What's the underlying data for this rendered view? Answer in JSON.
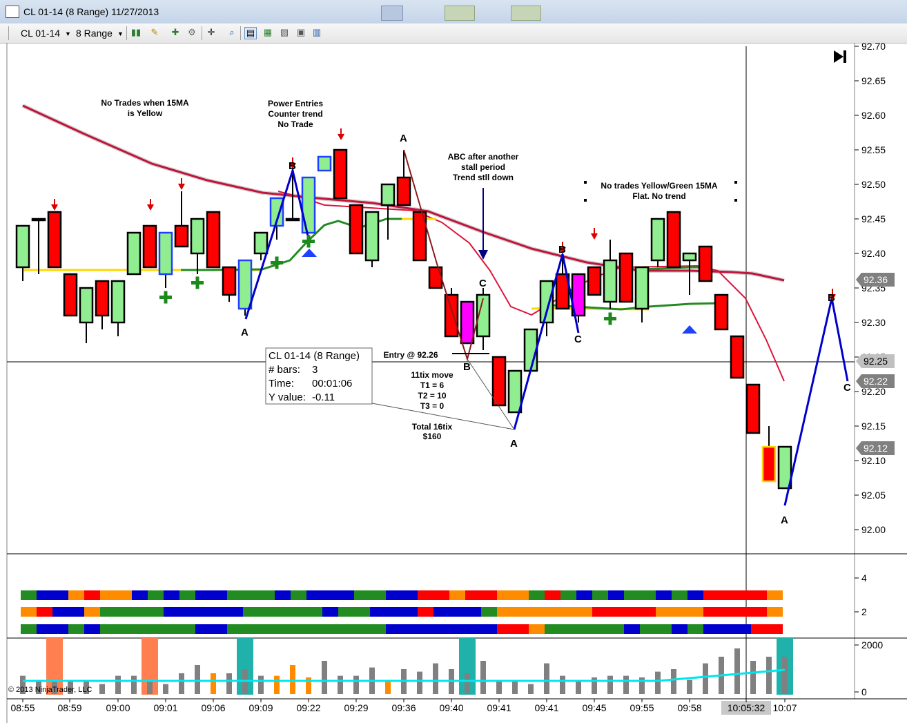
{
  "window": {
    "title": "CL 01-14 (8 Range)  11/27/2013",
    "minimized_thumbs": [
      "app-thumb-1",
      "app-thumb-2",
      "app-thumb-3"
    ]
  },
  "toolbar": {
    "instrument": "CL 01-14",
    "interval": "8 Range",
    "icons": [
      "bar-style-icon",
      "pencil-icon",
      "add-indicator-icon",
      "strategy-icon",
      "crosshair-icon",
      "zoom-icon",
      "data-box-icon",
      "chart-trader-icon",
      "chart-icon",
      "snapshot-icon",
      "properties-icon"
    ]
  },
  "price_axis": {
    "ticks": [
      "92.70",
      "92.65",
      "92.60",
      "92.55",
      "92.50",
      "92.45",
      "92.40",
      "92.35",
      "92.30",
      "92.25",
      "92.20",
      "92.15",
      "92.10",
      "92.05",
      "92.00"
    ],
    "markers": [
      {
        "label": "92.36",
        "bg": "#808080"
      },
      {
        "label": "92.25",
        "bg": "#c0c0c0"
      },
      {
        "label": "92.22",
        "bg": "#808080"
      },
      {
        "label": "92.12",
        "bg": "#808080"
      }
    ]
  },
  "time_axis": {
    "labels": [
      "08:55",
      "08:59",
      "09:00",
      "09:01",
      "09:06",
      "09:09",
      "09:22",
      "09:29",
      "09:36",
      "09:40",
      "09:41",
      "09:41",
      "09:45",
      "09:55",
      "09:58",
      "10:05:32",
      "10:07"
    ],
    "crosshair_label": "10:05:32"
  },
  "panel2_axis": {
    "ticks": [
      "4",
      "2"
    ]
  },
  "panel3_axis": {
    "ticks": [
      "2000",
      "0"
    ]
  },
  "annotations": {
    "no_trades_15ma": [
      "No Trades when 15MA",
      "is Yellow"
    ],
    "power_entries": [
      "Power Entries",
      "Counter trend",
      "No Trade"
    ],
    "abc_after": [
      "ABC after another",
      "stall period",
      "Trend stll down"
    ],
    "no_trades_yellow_green": [
      "No trades Yellow/Green 15MA",
      "Flat.  No trend"
    ],
    "entry": "Entry @ 92.26",
    "move": [
      "11tix move",
      "T1 = 6",
      "T2 = 10",
      "T3 = 0"
    ],
    "total": [
      "Total 16tix",
      "$160"
    ]
  },
  "wave_labels": [
    {
      "text": "A"
    },
    {
      "text": "B"
    },
    {
      "text": "A"
    },
    {
      "text": "B"
    },
    {
      "text": "C"
    },
    {
      "text": "A"
    },
    {
      "text": "B"
    },
    {
      "text": "C"
    },
    {
      "text": "A"
    },
    {
      "text": "B"
    },
    {
      "text": "C"
    }
  ],
  "data_box": {
    "title": "CL 01-14 (8 Range)",
    "rows": [
      {
        "label": "# bars:",
        "value": "3"
      },
      {
        "label": "Time:",
        "value": "00:01:06"
      },
      {
        "label": "Y value:",
        "value": "-0.11"
      }
    ]
  },
  "copyright": "© 2013 NinjaTrader, LLC",
  "colors": {
    "bull": "#90ee90",
    "bear": "#ff0000",
    "magenta": "#ff00ff",
    "ma_slow": "#c0143c",
    "ma_fast": "#dc143c",
    "ma15_green": "#228b22",
    "ma15_yellow": "#ffd700",
    "zigzag": "#0000cd",
    "volume": "#808080",
    "volume_avg": "#00e5ee"
  },
  "chart_data": {
    "type": "candlestick",
    "ylim": [
      91.96,
      92.7
    ],
    "candles": [
      {
        "o": 92.38,
        "h": 92.44,
        "l": 92.36,
        "c": 92.44
      },
      {
        "o": 92.45,
        "h": 92.45,
        "l": 92.37,
        "c": 92.45
      },
      {
        "o": 92.46,
        "h": 92.46,
        "l": 92.38,
        "c": 92.38
      },
      {
        "o": 92.37,
        "h": 92.37,
        "l": 92.31,
        "c": 92.31
      },
      {
        "o": 92.3,
        "h": 92.35,
        "l": 92.27,
        "c": 92.35
      },
      {
        "o": 92.36,
        "h": 92.36,
        "l": 92.29,
        "c": 92.31
      },
      {
        "o": 92.3,
        "h": 92.36,
        "l": 92.28,
        "c": 92.36
      },
      {
        "o": 92.37,
        "h": 92.43,
        "l": 92.37,
        "c": 92.43
      },
      {
        "o": 92.44,
        "h": 92.44,
        "l": 92.38,
        "c": 92.38
      },
      {
        "o": 92.37,
        "h": 92.43,
        "l": 92.35,
        "c": 92.43
      },
      {
        "o": 92.44,
        "h": 92.49,
        "l": 92.41,
        "c": 92.41
      },
      {
        "o": 92.4,
        "h": 92.45,
        "l": 92.37,
        "c": 92.45
      },
      {
        "o": 92.46,
        "h": 92.46,
        "l": 92.38,
        "c": 92.38
      },
      {
        "o": 92.38,
        "h": 92.38,
        "l": 92.33,
        "c": 92.34
      },
      {
        "o": 92.32,
        "h": 92.39,
        "l": 92.31,
        "c": 92.39
      },
      {
        "o": 92.4,
        "h": 92.43,
        "l": 92.39,
        "c": 92.43
      },
      {
        "o": 92.44,
        "h": 92.48,
        "l": 92.42,
        "c": 92.48
      },
      {
        "o": 92.45,
        "h": 92.52,
        "l": 92.45,
        "c": 92.45
      },
      {
        "o": 92.43,
        "h": 92.51,
        "l": 92.43,
        "c": 92.51
      },
      {
        "o": 92.52,
        "h": 92.54,
        "l": 92.52,
        "c": 92.54
      },
      {
        "o": 92.55,
        "h": 92.55,
        "l": 92.48,
        "c": 92.48
      },
      {
        "o": 92.47,
        "h": 92.47,
        "l": 92.4,
        "c": 92.4
      },
      {
        "o": 92.39,
        "h": 92.46,
        "l": 92.38,
        "c": 92.46
      },
      {
        "o": 92.47,
        "h": 92.5,
        "l": 92.42,
        "c": 92.5
      },
      {
        "o": 92.51,
        "h": 92.55,
        "l": 92.47,
        "c": 92.47
      },
      {
        "o": 92.46,
        "h": 92.46,
        "l": 92.39,
        "c": 92.39
      },
      {
        "o": 92.38,
        "h": 92.38,
        "l": 92.35,
        "c": 92.35
      },
      {
        "o": 92.34,
        "h": 92.35,
        "l": 92.28,
        "c": 92.28
      },
      {
        "o": 92.33,
        "h": 92.33,
        "l": 92.27,
        "c": 92.27
      },
      {
        "o": 92.28,
        "h": 92.35,
        "l": 92.26,
        "c": 92.34
      },
      {
        "o": 92.25,
        "h": 92.25,
        "l": 92.18,
        "c": 92.18
      },
      {
        "o": 92.17,
        "h": 92.23,
        "l": 92.17,
        "c": 92.23
      },
      {
        "o": 92.23,
        "h": 92.29,
        "l": 92.23,
        "c": 92.29
      },
      {
        "o": 92.3,
        "h": 92.36,
        "l": 92.28,
        "c": 92.36
      },
      {
        "o": 92.37,
        "h": 92.4,
        "l": 92.32,
        "c": 92.32
      },
      {
        "o": 92.31,
        "h": 92.37,
        "l": 92.3,
        "c": 92.37
      },
      {
        "o": 92.38,
        "h": 92.38,
        "l": 92.34,
        "c": 92.34
      },
      {
        "o": 92.33,
        "h": 92.42,
        "l": 92.32,
        "c": 92.39
      },
      {
        "o": 92.4,
        "h": 92.4,
        "l": 92.33,
        "c": 92.33
      },
      {
        "o": 92.32,
        "h": 92.38,
        "l": 92.3,
        "c": 92.38
      },
      {
        "o": 92.39,
        "h": 92.45,
        "l": 92.38,
        "c": 92.45
      },
      {
        "o": 92.46,
        "h": 92.46,
        "l": 92.38,
        "c": 92.38
      },
      {
        "o": 92.39,
        "h": 92.4,
        "l": 92.34,
        "c": 92.4
      },
      {
        "o": 92.41,
        "h": 92.41,
        "l": 92.36,
        "c": 92.36
      },
      {
        "o": 92.34,
        "h": 92.34,
        "l": 92.29,
        "c": 92.29
      },
      {
        "o": 92.28,
        "h": 92.28,
        "l": 92.22,
        "c": 92.22
      },
      {
        "o": 92.21,
        "h": 92.21,
        "l": 92.14,
        "c": 92.14
      },
      {
        "o": 92.12,
        "h": 92.15,
        "l": 92.07,
        "c": 92.07
      },
      {
        "o": 92.06,
        "h": 92.12,
        "l": 92.06,
        "c": 92.12
      }
    ]
  }
}
